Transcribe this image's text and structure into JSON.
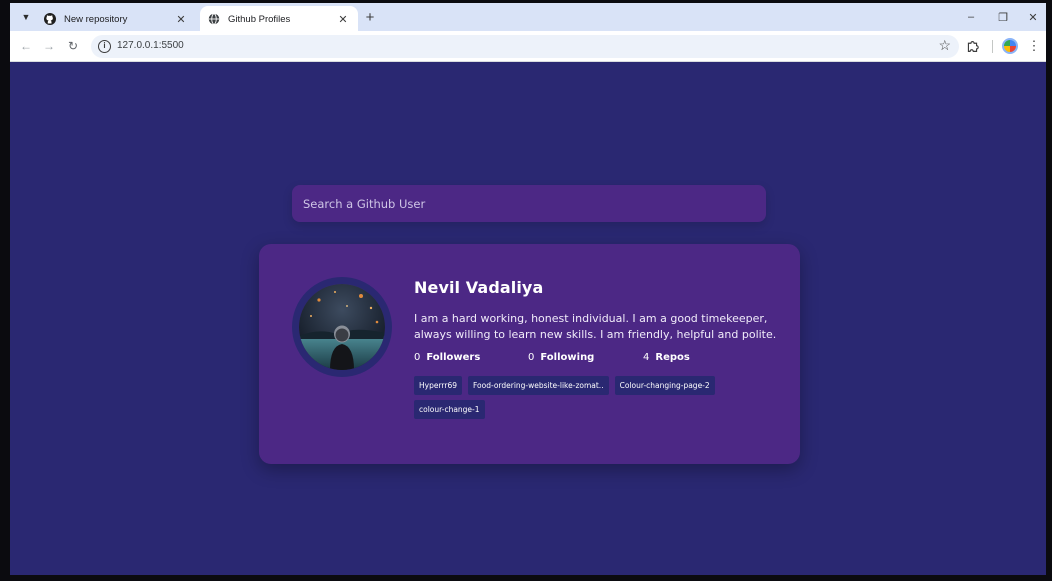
{
  "browser": {
    "tabs": [
      {
        "title": "New repository",
        "icon": "github-icon",
        "active": false
      },
      {
        "title": "Github Profiles",
        "icon": "globe-icon",
        "active": true
      }
    ],
    "url": "127.0.0.1:5500"
  },
  "search": {
    "placeholder": "Search a Github User"
  },
  "profile": {
    "name": "Nevil Vadaliya",
    "bio": "I am a hard working, honest individual. I am a good timekeeper, always willing to learn new skills. I am friendly, helpful and polite.",
    "stats": [
      {
        "value": "0",
        "label": "Followers"
      },
      {
        "value": "0",
        "label": "Following"
      },
      {
        "value": "4",
        "label": "Repos"
      }
    ],
    "repos": [
      "Hyperrr69",
      "Food-ordering-website-like-zomat..",
      "Colour-changing-page-2",
      "colour-change-1"
    ]
  },
  "colors": {
    "page_bg": "#2a2872",
    "card_bg": "#4c2885",
    "repo_bg": "#2a2872",
    "text": "#ffffff"
  }
}
